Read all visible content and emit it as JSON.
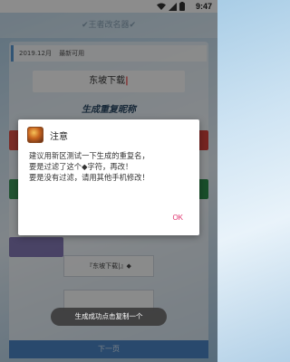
{
  "status_bar": {
    "time": "9:47",
    "icons": [
      "wifi-icon",
      "signal-icon",
      "battery-icon"
    ]
  },
  "app_bar": {
    "title": "✔王者改名器✔"
  },
  "news": {
    "date": "2019.12月",
    "text": "最新可用"
  },
  "name_input": {
    "value": "东坡下载",
    "caret": "|"
  },
  "generate": {
    "title": "生成重复昵称"
  },
  "buttons": {
    "sub1_label": "『东坡下载|』◆",
    "sub2_label": "",
    "next_label": "下一页"
  },
  "dialog": {
    "title": "注意",
    "message": "建议用新区测试一下生成的重复名，\n要是过滤了这个◆字符，再改！\n要是没有过滤，请用其他手机修改！",
    "ok_label": "OK"
  },
  "toast": {
    "text": "生成成功点击复制一个"
  },
  "colors": {
    "accent_blue": "#4b86c6",
    "ok_pink": "#e0336e",
    "red_button": "#e05248",
    "green_button": "#3f9a5c",
    "purple_button": "#6a5aa8"
  }
}
